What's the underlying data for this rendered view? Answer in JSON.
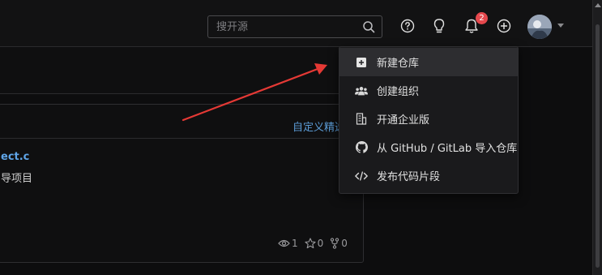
{
  "header": {
    "search_placeholder": "搜开源",
    "notification_count": "2",
    "icons": [
      "help-icon",
      "lightbulb-icon",
      "bell-icon",
      "plus-icon"
    ]
  },
  "feed": {
    "customize_link": "自定义精选",
    "project_name": "ect.c",
    "project_desc": "导项目",
    "stats": {
      "watch": "1",
      "star": "0",
      "fork": "0"
    }
  },
  "dropdown": {
    "items": [
      {
        "label": "新建仓库",
        "icon": "plus-square-icon"
      },
      {
        "label": "创建组织",
        "icon": "users-icon"
      },
      {
        "label": "开通企业版",
        "icon": "building-icon"
      },
      {
        "label": "从 GitHub / GitLab 导入仓库",
        "icon": "github-icon"
      },
      {
        "label": "发布代码片段",
        "icon": "code-icon"
      }
    ]
  },
  "colors": {
    "annotation_arrow": "#e53935",
    "badge": "#e5484d",
    "link": "#5b9bd5"
  }
}
